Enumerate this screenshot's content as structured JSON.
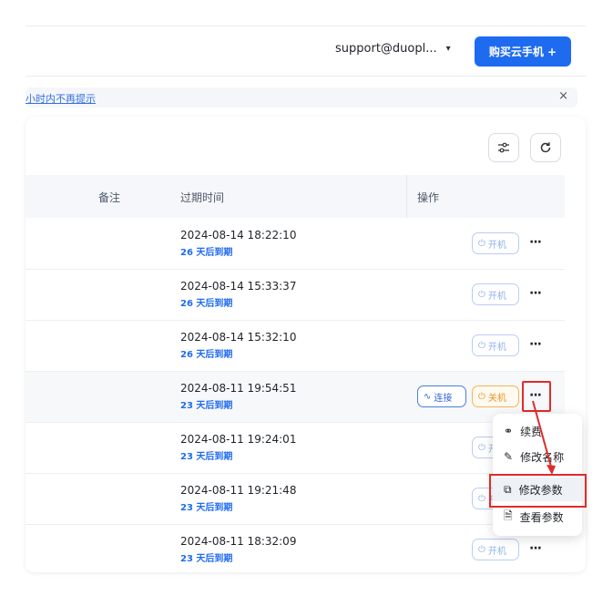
{
  "header": {
    "account": "support@duopl...",
    "buy_label": "购买云手机 +"
  },
  "notice": {
    "text": "小时内不再提示",
    "close": "×"
  },
  "toolbar": {
    "filter_icon": "sliders-icon",
    "refresh_icon": "refresh-icon"
  },
  "table": {
    "columns": {
      "note": "备注",
      "expire": "过期时间",
      "actions": "操作"
    },
    "rows": [
      {
        "date": "2024-08-14 18:22:10",
        "expiry": "26 天后到期",
        "state": "off"
      },
      {
        "date": "2024-08-14 15:33:37",
        "expiry": "26 天后到期",
        "state": "off"
      },
      {
        "date": "2024-08-14 15:32:10",
        "expiry": "26 天后到期",
        "state": "off"
      },
      {
        "date": "2024-08-11 19:54:51",
        "expiry": "23 天后到期",
        "state": "on"
      },
      {
        "date": "2024-08-11 19:24:01",
        "expiry": "23 天后到期",
        "state": "off"
      },
      {
        "date": "2024-08-11 19:21:48",
        "expiry": "23 天后到期",
        "state": "off"
      },
      {
        "date": "2024-08-11 18:32:09",
        "expiry": "23 天后到期",
        "state": "off"
      }
    ],
    "power_on_label": "开机",
    "power_off_label": "关机",
    "connect_label": "连接",
    "more_label": "···"
  },
  "menu": {
    "items": [
      {
        "label": "续费",
        "icon": "renew-icon"
      },
      {
        "label": "修改名称",
        "icon": "edit-icon"
      },
      {
        "label": "修改参数",
        "icon": "params-icon"
      },
      {
        "label": "查看参数",
        "icon": "document-icon"
      }
    ]
  },
  "colors": {
    "accent": "#1e6bf0",
    "highlight": "#e02b2b",
    "warn": "#e8951e"
  }
}
